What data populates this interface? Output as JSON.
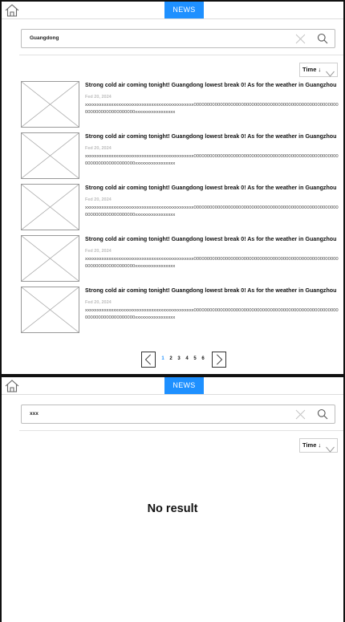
{
  "header": {
    "tab_label": "NEWS"
  },
  "screen1": {
    "search_value": "Guangdong",
    "sort_label": "Time ↓",
    "articles": [
      {
        "title": "Strong cold air coming tonight! Guangdong lowest break 0! As for the weather in Guangzhou",
        "date": "Fed 20, 2024",
        "body": "xxxxxxxxxxxxxxxxxxxxxxxxxxxxxxxxxxxxxxxxxxxxxx00000000000000000000000000000000000000000000000000000000000000000000000000xxxxxxxxxxxxxxxxx"
      },
      {
        "title": "Strong cold air coming tonight! Guangdong lowest break 0! As for the weather in Guangzhou",
        "date": "Fed 20, 2024",
        "body": "xxxxxxxxxxxxxxxxxxxxxxxxxxxxxxxxxxxxxxxxxxxxxx00000000000000000000000000000000000000000000000000000000000000000000000000xxxxxxxxxxxxxxxxx"
      },
      {
        "title": "Strong cold air coming tonight! Guangdong lowest break 0! As for the weather in Guangzhou",
        "date": "Fed 20, 2024",
        "body": "xxxxxxxxxxxxxxxxxxxxxxxxxxxxxxxxxxxxxxxxxxxxxx00000000000000000000000000000000000000000000000000000000000000000000000000xxxxxxxxxxxxxxxxx"
      },
      {
        "title": "Strong cold air coming tonight! Guangdong lowest break 0! As for the weather in Guangzhou",
        "date": "Fed 20, 2024",
        "body": "xxxxxxxxxxxxxxxxxxxxxxxxxxxxxxxxxxxxxxxxxxxxxx00000000000000000000000000000000000000000000000000000000000000000000000000xxxxxxxxxxxxxxxxx"
      },
      {
        "title": "Strong cold air coming tonight! Guangdong lowest break 0! As for the weather in Guangzhou",
        "date": "Fed 20, 2024",
        "body": "xxxxxxxxxxxxxxxxxxxxxxxxxxxxxxxxxxxxxxxxxxxxxx00000000000000000000000000000000000000000000000000000000000000000000000000xxxxxxxxxxxxxxxxx"
      }
    ],
    "pagination": {
      "pages": [
        "1",
        "2",
        "3",
        "4",
        "5",
        "6"
      ],
      "current": "1"
    }
  },
  "screen2": {
    "search_value": "xxx",
    "sort_label": "Time ↓",
    "empty_message": "No result"
  },
  "colors": {
    "accent": "#1e90ff",
    "date_text": "#bdbdbd",
    "border": "#111111"
  },
  "icons": [
    "home-icon",
    "clear-icon",
    "search-icon",
    "chevron-down-icon",
    "chevron-left-icon",
    "chevron-right-icon",
    "image-placeholder-icon"
  ]
}
